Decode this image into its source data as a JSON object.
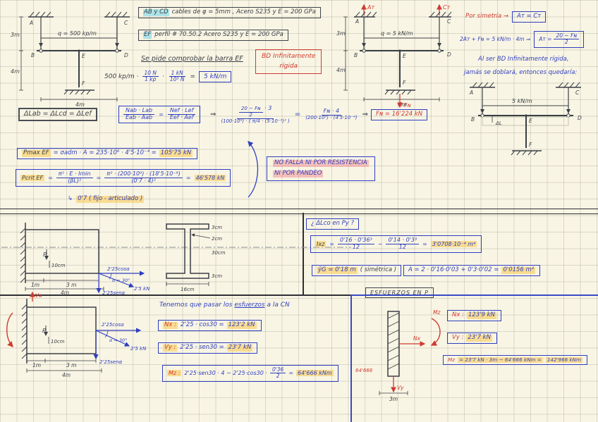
{
  "colors": {
    "ink": "#3a3f47",
    "blue": "#2e3fc0",
    "red": "#cf3a31",
    "cyan_highlight": "#84d8ea",
    "yellow_highlight": "#f8cd5f",
    "pink_highlight": "#f39498",
    "paper": "#f9f5e4"
  },
  "labels": {
    "A": "A",
    "B": "B",
    "C": "C",
    "D": "D",
    "E": "E",
    "F": "F",
    "P": "P",
    "dL": "ΔL",
    "AT": "Aᴛ",
    "CT": "Cᴛ",
    "FN": "Fɴ",
    "VA": "Vᴀ"
  },
  "dims": {
    "m1": "1m",
    "m3": "3m",
    "m3sp": "3 m",
    "m4": "4m",
    "cm10": "10cm",
    "cm3": "3cm",
    "cm2": "2cm",
    "cm30": "30cm",
    "cm16": "16cm",
    "q1": "q = 500 kp/m",
    "q2": "q = 5 kN/m",
    "q3": "5 kN/m"
  },
  "p1": {
    "given1_hl": "AB y CD",
    "given1": "cables de φ = 5mm ,  Acero S235  y  E = 200 GPa",
    "given2_hl": "EF",
    "given2": "perfil # 70.50.2   Acero S235  y  E = 200 GPa",
    "task": "Se pide comprobar la barra EF",
    "rigid_box1": "BD Infinitamente",
    "rigid_box2": "rígida",
    "conv_lhs": "500 kp/m ·",
    "conv_f1n": "10 N",
    "conv_f1d": "1 kp",
    "conv_dot": "·",
    "conv_f2n": "1 kN",
    "conv_f2d": "10³ N",
    "conv_eq": "=",
    "conv_res": "5 kN/m",
    "sym1": "Por simetría  →",
    "sym1_box": "Aᴛ = Cᴛ",
    "sym2": "2Aᴛ + Fɴ = 5 kN/m · 4m  ⇒",
    "sym2_pre": "Aᴛ =",
    "sym2_n": "20 − Fɴ",
    "sym2_d": "2",
    "rigid1": "Al ser BD Infinitamente rígida,",
    "rigid2": "jamás se doblará, entonces quedaría:",
    "compat": "ΔLab = ΔLcd = ΔLef",
    "el_n1": "Nab · Lab",
    "el_d1": "Eab · Aab",
    "eq": "=",
    "el_n2": "Nef · Lef",
    "el_d2": "Eef · Aef",
    "imp": "⇒",
    "beq_in_n": "20 − Fɴ",
    "beq_in_d": "2",
    "beq_n1b": "· 3",
    "beq_d1": "(100·10⁹) · ( π/4 · (5·10⁻³)² )",
    "beq_n2": "Fɴ · 4",
    "beq_d2": "(200·10⁹) · (4'5·10⁻⁴)",
    "fn_res": "Fɴ = 16'224 kN",
    "pmax_hl": "Pmax EF",
    "pmax_mid": "= σadm · A = 235·10⁶ · 4'5·10⁻⁴ =",
    "pmax_res": "105'75 kN",
    "pcrit_hl": "Pcrit EF",
    "pcrit_n1": "π² · E · Imin",
    "pcrit_d1": "(βL)²",
    "pcrit_n2": "π² · (200·10⁹) · (18'5·10⁻⁸)",
    "pcrit_d2": "(0'7 · 4)²",
    "pcrit_res": "46'578 kN",
    "beta_arrow": "↳",
    "beta_note": "0'7  ( fijo - articulado )",
    "concl1": "NO FALLA NI POR RESISTENCIA",
    "concl2": "NI  POR  PANDEO"
  },
  "p2": {
    "question": "¿ ΔLco en Py ?",
    "ixz_hl": "Ixz",
    "ixz_eq1": "=",
    "ixz_n1": "0'16 · 0'36³",
    "ixz_d1": "12",
    "minus": "−",
    "ixz_n2": "0'14 · 0'3³",
    "ixz_d2": "12",
    "ixz_eq2": "=",
    "ixz_res": "3'0708·10⁻⁴ m⁴",
    "ybar_hl": "ȳG = 0'18 m",
    "ybar_note": "( simétrica )",
    "area": "A = 2 · 0'16·0'03 + 0'3·0'02 =",
    "area_res": "0'0156 m²",
    "f_cos": "2'25cosα",
    "f_diag": "2'5 kN",
    "f_ang": "α = 30°",
    "f_sen": "2'25senα",
    "transfer_a": "Tenemos que pasar los ",
    "transfer_b": "esfuerzos",
    "transfer_c": " a la CN",
    "nx_hl": "Nx :",
    "nx_mid": "2'25 · cos30 =",
    "nx_res": "123'2 kN",
    "vy_hl": "Vy :",
    "vy_mid": "2'25 · sen30 =",
    "vy_res": "23'7 kN",
    "mz_hl": "Mz :",
    "mz_mid1": "2'25·sen30 · 4  −  2'25·cos30 ·",
    "mz_fn": "0'36",
    "mz_fd": "2",
    "mz_eq": "=",
    "mz_res": "64'666 kNm",
    "esf_title": "ESFUERZOS EN P",
    "sk_mz": "Mz",
    "sk_nx": "Nx",
    "sk_vy": "Vy",
    "sk_m": "64'666",
    "sk_dim": "3m",
    "rnx_l": "Nx :",
    "rnx_res": "123'9 kN",
    "rvy_l": "Vy :",
    "rvy_res": "23'7 kN",
    "rmz_l": "Mz",
    "rmz_mid": "= 23'7 kN · 3m − 64'666 kNm =",
    "rmz_res": "142'966 kNm"
  }
}
